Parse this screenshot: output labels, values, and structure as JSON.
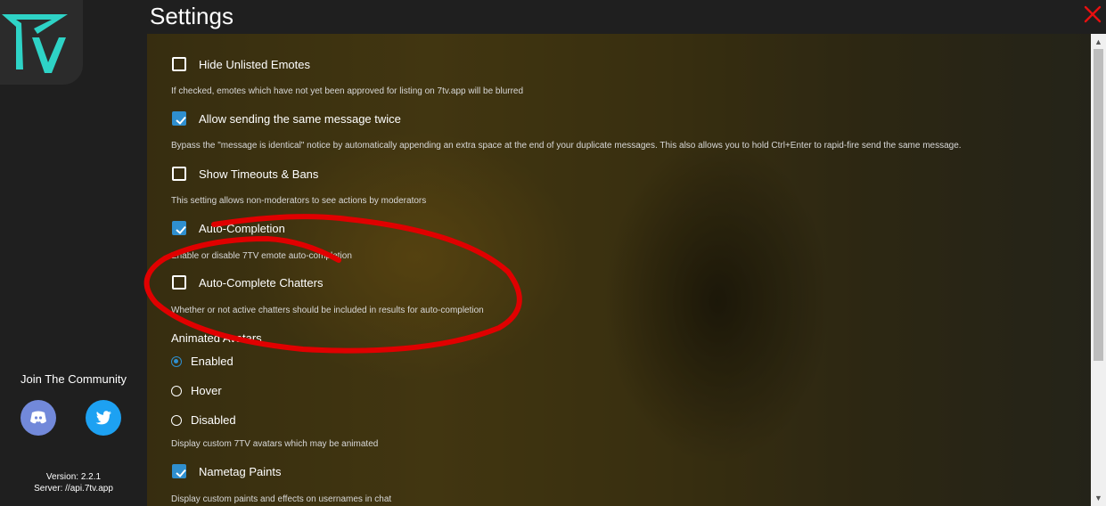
{
  "header": {
    "title": "Settings",
    "close_icon": "close-icon"
  },
  "sidebar": {
    "logo_icon": "7tv-logo-icon",
    "community_label": "Join The Community",
    "social": [
      {
        "icon": "discord-icon",
        "color": "#7289da"
      },
      {
        "icon": "twitter-icon",
        "color": "#1da1f2"
      }
    ],
    "version": "Version: 2.2.1",
    "server": "Server: //api.7tv.app"
  },
  "settings": [
    {
      "label": "Hide Unlisted Emotes",
      "checked": false,
      "description": "If checked, emotes which have not yet been approved for listing on 7tv.app will be blurred"
    },
    {
      "label": "Allow sending the same message twice",
      "checked": true,
      "description": "Bypass the \"message is identical\" notice by automatically appending an extra space at the end of your duplicate messages. This also allows you to hold Ctrl+Enter to rapid-fire send the same message."
    },
    {
      "label": "Show Timeouts & Bans",
      "checked": false,
      "description": "This setting allows non-moderators to see actions by moderators"
    },
    {
      "label": "Auto-Completion",
      "checked": true,
      "description": "Enable or disable 7TV emote auto-completion"
    },
    {
      "label": "Auto-Complete Chatters",
      "checked": false,
      "description": "Whether or not active chatters should be included in results for auto-completion"
    }
  ],
  "animated_avatars": {
    "title": "Animated Avatars",
    "options": [
      "Enabled",
      "Hover",
      "Disabled"
    ],
    "selected": "Enabled",
    "description": "Display custom 7TV avatars which may be animated"
  },
  "nametag": {
    "label": "Nametag Paints",
    "checked": true,
    "description": "Display custom paints and effects on usernames in chat"
  },
  "colors": {
    "accent": "#2f8fcf",
    "annotation": "#e00000",
    "logo": "#2ed3c6",
    "close": "#e81010"
  }
}
